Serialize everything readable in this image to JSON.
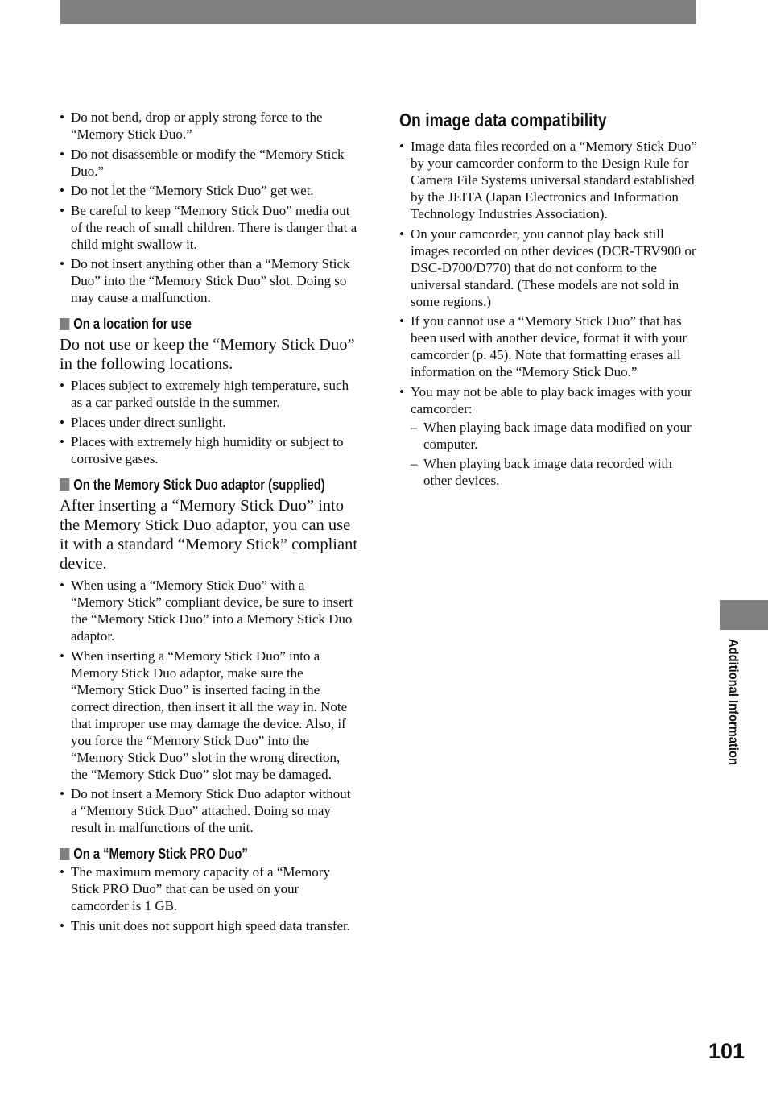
{
  "left_column": {
    "intro_bullets": [
      "Do not bend, drop or apply strong force to the “Memory Stick Duo.”",
      "Do not disassemble or modify the “Memory Stick Duo.”",
      "Do not let the “Memory Stick Duo” get wet.",
      "Be careful to keep “Memory Stick Duo” media out of the reach of small children. There is danger that a child might swallow it.",
      "Do not insert anything other than a “Memory Stick Duo” into the “Memory Stick Duo” slot. Doing so may cause a malfunction."
    ],
    "sections": [
      {
        "heading": "On a location for use",
        "intro": "Do not use or keep the “Memory Stick Duo” in the following locations.",
        "bullets": [
          "Places subject to extremely high temperature, such as a car parked outside in the summer.",
          "Places under direct sunlight.",
          "Places with extremely high humidity or subject to corrosive gases."
        ]
      },
      {
        "heading": "On the Memory Stick Duo adaptor (supplied)",
        "intro": "After inserting a “Memory Stick Duo” into the Memory Stick Duo adaptor, you can use it with a standard “Memory Stick” compliant device.",
        "bullets": [
          "When using a “Memory Stick Duo” with a “Memory Stick” compliant device, be sure to insert the “Memory Stick Duo” into a Memory Stick Duo adaptor.",
          "When inserting a “Memory Stick Duo” into a Memory Stick Duo adaptor, make sure the “Memory Stick Duo” is inserted facing in the correct direction, then insert it all the way in. Note that improper use may damage the device. Also, if you force the “Memory Stick Duo” into the “Memory Stick Duo” slot in the wrong direction, the “Memory Stick Duo” slot may be damaged.",
          "Do not insert a Memory Stick Duo adaptor without a “Memory Stick Duo” attached. Doing so may result in malfunctions of the unit."
        ]
      },
      {
        "heading": "On a “Memory Stick PRO Duo”",
        "bullets": [
          "The maximum memory capacity of a “Memory Stick PRO Duo” that can be used on your camcorder is 1 GB.",
          "This unit does not support high speed data transfer."
        ]
      }
    ]
  },
  "right_column": {
    "heading": "On image data compatibility",
    "bullets": [
      "Image data files recorded on a “Memory Stick Duo” by your camcorder conform to the Design Rule for Camera File Systems universal standard established by the JEITA (Japan Electronics and Information Technology Industries Association).",
      "On your camcorder, you cannot play back still images recorded on other devices (DCR-TRV900 or DSC-D700/D770) that do not conform to the universal standard. (These models are not sold in some regions.)",
      "If you cannot use a “Memory Stick Duo” that has been used with another device, format it with your camcorder (p. 45). Note that formatting erases all information on the “Memory Stick Duo.”",
      "You may not be able to play back images with your camcorder:"
    ],
    "sub_items": [
      "When playing back image data modified on your computer.",
      "When playing back image data recorded with other devices."
    ]
  },
  "side_tab": {
    "label": "Additional Information"
  },
  "page_number": "101"
}
